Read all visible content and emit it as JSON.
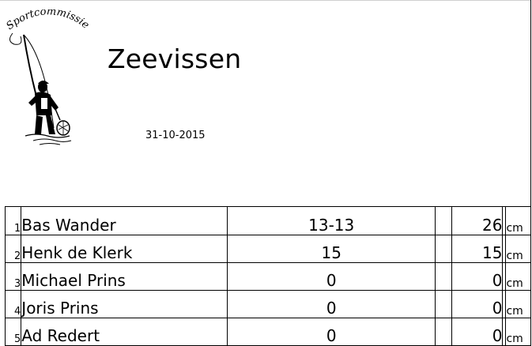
{
  "header": {
    "logo_text": "Sportcommissie",
    "title": "Zeevissen",
    "date": "31-10-2015"
  },
  "results": {
    "unit": "cm",
    "rows": [
      {
        "rank": "1",
        "name": "Bas Wander",
        "catch": "13-13",
        "length": "26",
        "unit": "cm"
      },
      {
        "rank": "2",
        "name": "Henk de Klerk",
        "catch": "15",
        "length": "15",
        "unit": "cm"
      },
      {
        "rank": "3",
        "name": "Michael Prins",
        "catch": "0",
        "length": "0",
        "unit": "cm"
      },
      {
        "rank": "4",
        "name": "Joris Prins",
        "catch": "0",
        "length": "0",
        "unit": "cm"
      },
      {
        "rank": "5",
        "name": "Ad Redert",
        "catch": "0",
        "length": "0",
        "unit": "cm"
      }
    ]
  }
}
